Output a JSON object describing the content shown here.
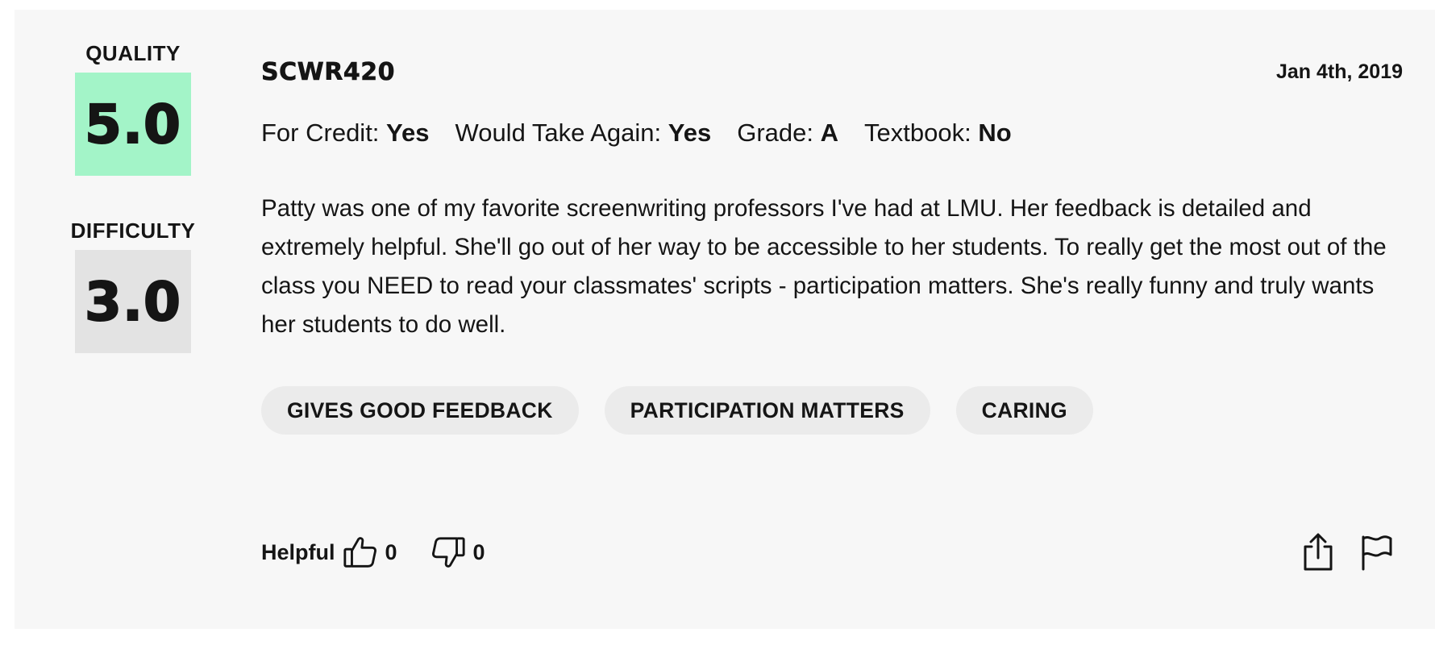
{
  "ratings": {
    "quality_label": "QUALITY",
    "quality_value": "5.0",
    "difficulty_label": "DIFFICULTY",
    "difficulty_value": "3.0",
    "quality_color": "#a3f4c8",
    "difficulty_color": "#e3e3e3"
  },
  "review": {
    "course": "SCWR420",
    "date": "Jan 4th, 2019",
    "meta": [
      {
        "label": "For Credit:",
        "value": "Yes"
      },
      {
        "label": "Would Take Again:",
        "value": "Yes"
      },
      {
        "label": "Grade:",
        "value": "A"
      },
      {
        "label": "Textbook:",
        "value": "No"
      }
    ],
    "comment": "Patty was one of my favorite screenwriting professors I've had at LMU. Her feedback is detailed and extremely helpful. She'll go out of her way to be accessible to her students. To really get the most out of the class you NEED to read your classmates' scripts - participation matters. She's really funny and truly wants her students to do well.",
    "tags": [
      "GIVES GOOD FEEDBACK",
      "PARTICIPATION MATTERS",
      "CARING"
    ]
  },
  "footer": {
    "helpful_label": "Helpful",
    "thumbs_up_icon": "thumbs-up-icon",
    "thumbs_up_count": "0",
    "thumbs_down_icon": "thumbs-down-icon",
    "thumbs_down_count": "0",
    "share_icon": "share-icon",
    "flag_icon": "flag-icon"
  }
}
